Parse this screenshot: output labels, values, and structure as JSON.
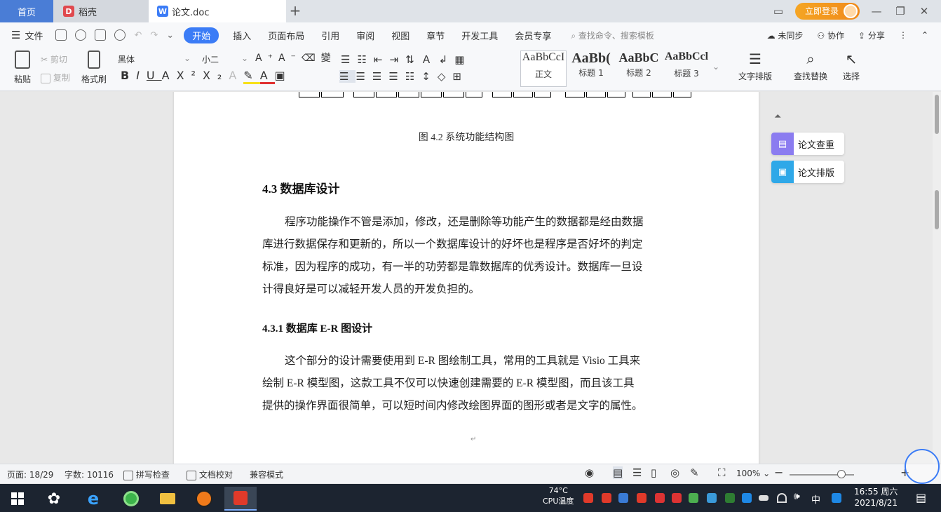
{
  "tabs": {
    "home": "首页",
    "docer": "稻壳",
    "doc": "论文.doc",
    "add": "+"
  },
  "titlebar": {
    "login": "立即登录"
  },
  "menu": {
    "file": "文件",
    "items": [
      "开始",
      "插入",
      "页面布局",
      "引用",
      "审阅",
      "视图",
      "章节",
      "开发工具",
      "会员专享"
    ],
    "search_placeholder": "查找命令、搜索模板",
    "sync": "未同步",
    "collab": "协作",
    "share": "分享"
  },
  "ribbon": {
    "paste": "粘贴",
    "cut": "剪切",
    "copy": "复制",
    "format_painter": "格式刷",
    "font_name": "黑体",
    "font_size": "小二",
    "styles": [
      {
        "preview": "AaBbCcI",
        "name": "正文"
      },
      {
        "preview": "AaBb(",
        "name": "标题 1"
      },
      {
        "preview": "AaBbC",
        "name": "标题 2"
      },
      {
        "preview": "AaBbCcl",
        "name": "标题 3"
      }
    ],
    "text_layout": "文字排版",
    "find_replace": "查找替换",
    "select": "选择"
  },
  "document": {
    "figure_caption": "图 4.2  系统功能结构图",
    "section_43": "4.3  数据库设计",
    "para1_lines": [
      "程序功能操作不管是添加，修改，还是删除等功能产生的数据都是经由数据",
      "库进行数据保存和更新的，所以一个数据库设计的好坏也是程序是否好坏的判定",
      "标准，因为程序的成功，有一半的功劳都是靠数据库的优秀设计。数据库一旦设",
      "计得良好是可以减轻开发人员的开发负担的。"
    ],
    "section_431": "4.3.1  数据库 E-R 图设计",
    "para2_lines": [
      "这个部分的设计需要使用到 E-R 图绘制工具，常用的工具就是 Visio 工具来",
      "绘制 E-R 模型图，这款工具不仅可以快速创建需要的 E-R 模型图，而且该工具",
      "提供的操作界面很简单，可以短时间内修改绘图界面的图形或者是文字的属性。"
    ],
    "page_return_mark": "↵"
  },
  "right_panel": {
    "plagiarism_check": "论文查重",
    "paper_format": "论文排版"
  },
  "status": {
    "page": "页面: 18/29",
    "word_count": "字数: 10116",
    "spell_check": "拼写检查",
    "doc_proof": "文档校对",
    "compat_mode": "兼容模式",
    "zoom": "100%"
  },
  "taskbar": {
    "weather_temp": "74°C",
    "weather_label": "CPU温度",
    "ime": "中",
    "time": "16:55 周六",
    "date": "2021/8/21"
  },
  "colors": {
    "accent": "#3b7cf6",
    "tab_home": "#4a7dd6",
    "login": "#f5a524",
    "taskbar": "#1c2430"
  }
}
